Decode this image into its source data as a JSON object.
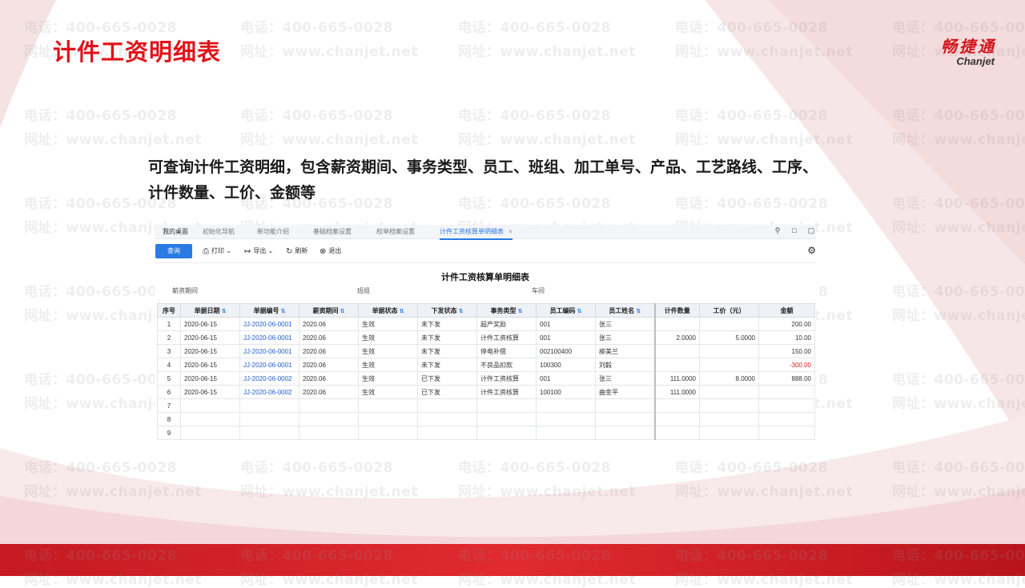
{
  "slide": {
    "title": "计件工资明细表",
    "description": "可查询计件工资明细，包含薪资期间、事务类型、员工、班组、加工单号、产品、工艺路线、工序、计件数量、工价、金额等",
    "logo_cn": "畅捷通",
    "logo_en": "Chanjet"
  },
  "watermark": {
    "phone": "电话：400-665-0028",
    "url": "网址：www.chanjet.net"
  },
  "colors": {
    "brand_red": "#e1131a",
    "primary_blue": "#2a7ae4",
    "link_blue": "#1f5bd6",
    "negative_red": "#e02020"
  },
  "app": {
    "tabs": [
      {
        "label": "我的桌面"
      },
      {
        "label": "初始化导航"
      },
      {
        "label": "新功能介绍"
      },
      {
        "label": "基础档案设置"
      },
      {
        "label": "权举档案设置"
      },
      {
        "label": "计件工资核算单明细表",
        "close": "×"
      }
    ],
    "tab_tools": {
      "search_icon": "search-icon",
      "expand_icon": "expand-icon",
      "window_icon": "window-icon"
    },
    "toolbar": {
      "query": "查询",
      "print": "打印",
      "export": "导出",
      "refresh": "刷新",
      "exit": "退出"
    },
    "report_title": "计件工资核算单明细表",
    "filters": {
      "period": "薪资期间",
      "team": "班组",
      "workshop": "车间"
    },
    "columns": [
      "序号",
      "单据日期",
      "单据编号",
      "薪资期间",
      "单据状态",
      "下发状态",
      "事务类型",
      "员工编码",
      "员工姓名",
      "计件数量",
      "工价（元）",
      "金额"
    ],
    "rows": [
      {
        "idx": "1",
        "date": "2020-06-15",
        "no": "JJ-2020-06-0001",
        "period": "2020.06",
        "status": "生效",
        "issue": "未下发",
        "type": "超产奖励",
        "emp_code": "001",
        "emp_name": "张三",
        "qty": "",
        "price": "",
        "amount": "200.00"
      },
      {
        "idx": "2",
        "date": "2020-06-15",
        "no": "JJ-2020-06-0001",
        "period": "2020.06",
        "status": "生效",
        "issue": "未下发",
        "type": "计件工资核算",
        "emp_code": "001",
        "emp_name": "张三",
        "qty": "2.0000",
        "price": "5.0000",
        "amount": "10.00"
      },
      {
        "idx": "3",
        "date": "2020-06-15",
        "no": "JJ-2020-06-0001",
        "period": "2020.06",
        "status": "生效",
        "issue": "未下发",
        "type": "停电补偿",
        "emp_code": "002100400",
        "emp_name": "柳美兰",
        "qty": "",
        "price": "",
        "amount": "150.00"
      },
      {
        "idx": "4",
        "date": "2020-06-15",
        "no": "JJ-2020-06-0001",
        "period": "2020.06",
        "status": "生效",
        "issue": "未下发",
        "type": "不良品扣款",
        "emp_code": "100300",
        "emp_name": "刘毅",
        "qty": "",
        "price": "",
        "amount": "-300.00"
      },
      {
        "idx": "5",
        "date": "2020-06-15",
        "no": "JJ-2020-06-0002",
        "period": "2020.06",
        "status": "生效",
        "issue": "已下发",
        "type": "计件工资核算",
        "emp_code": "001",
        "emp_name": "张三",
        "qty": "111.0000",
        "price": "8.0000",
        "amount": "888.00"
      },
      {
        "idx": "6",
        "date": "2020-06-15",
        "no": "JJ-2020-06-0002",
        "period": "2020.06",
        "status": "生效",
        "issue": "已下发",
        "type": "计件工资核算",
        "emp_code": "100100",
        "emp_name": "曲金平",
        "qty": "111.0000",
        "price": "",
        "amount": ""
      },
      {
        "idx": "7",
        "date": "",
        "no": "",
        "period": "",
        "status": "",
        "issue": "",
        "type": "",
        "emp_code": "",
        "emp_name": "",
        "qty": "",
        "price": "",
        "amount": ""
      },
      {
        "idx": "8",
        "date": "",
        "no": "",
        "period": "",
        "status": "",
        "issue": "",
        "type": "",
        "emp_code": "",
        "emp_name": "",
        "qty": "",
        "price": "",
        "amount": ""
      },
      {
        "idx": "9",
        "date": "",
        "no": "",
        "period": "",
        "status": "",
        "issue": "",
        "type": "",
        "emp_code": "",
        "emp_name": "",
        "qty": "",
        "price": "",
        "amount": ""
      }
    ]
  }
}
